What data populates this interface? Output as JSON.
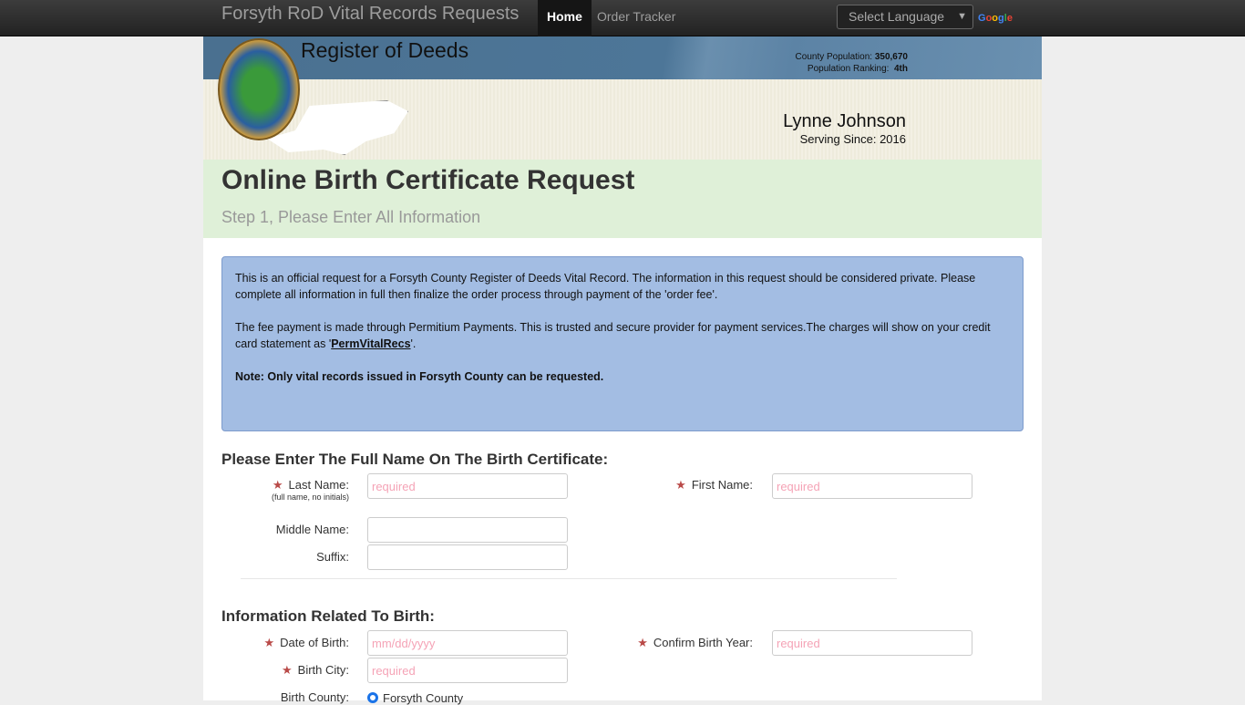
{
  "nav": {
    "brand": "Forsyth RoD Vital Records Requests",
    "links": [
      "Home",
      "Order Tracker"
    ],
    "active": "Home",
    "language": "Select Language",
    "google": "Google"
  },
  "header": {
    "office": "Register of Deeds",
    "population_label": "County Population:",
    "population": "350,670",
    "ranking_label": "Population Ranking:",
    "ranking": "4th",
    "register_name": "Lynne Johnson",
    "serving_label": "Serving Since:",
    "serving_year": "2016"
  },
  "page": {
    "title": "Online Birth Certificate Request",
    "step": "Step 1, Please Enter All Information"
  },
  "info": {
    "p1": "This is an official request for a Forsyth County Register of Deeds Vital Record. The information in this request should be considered private. Please complete all information in full then finalize the order process through payment of the 'order fee'.",
    "p2_pre": "The fee payment is made through Permitium Payments. This is trusted and secure provider for payment services.The charges will show on your credit card  statement as '",
    "p2_link": "PermVitalRecs",
    "p2_post": "'.",
    "note": "Note: Only vital records issued in Forsyth County can be requested."
  },
  "name_section": {
    "heading": "Please Enter The Full Name On The Birth Certificate:",
    "last_name": "Last Name:",
    "last_hint": "(full name, no initials)",
    "first_name": "First Name:",
    "middle_name": "Middle Name:",
    "suffix": "Suffix:",
    "required_placeholder": "required"
  },
  "birth_section": {
    "heading": "Information Related To Birth:",
    "dob": "Date of Birth:",
    "dob_placeholder": "mm/dd/yyyy",
    "confirm_year": "Confirm Birth Year:",
    "city": "Birth City:",
    "county": "Birth County:",
    "county_option": "Forsyth County",
    "required_placeholder": "required"
  },
  "colors": {
    "required_star": "#b94a48",
    "info_bg": "#a3bde3",
    "title_bg": "#dff0d8"
  }
}
